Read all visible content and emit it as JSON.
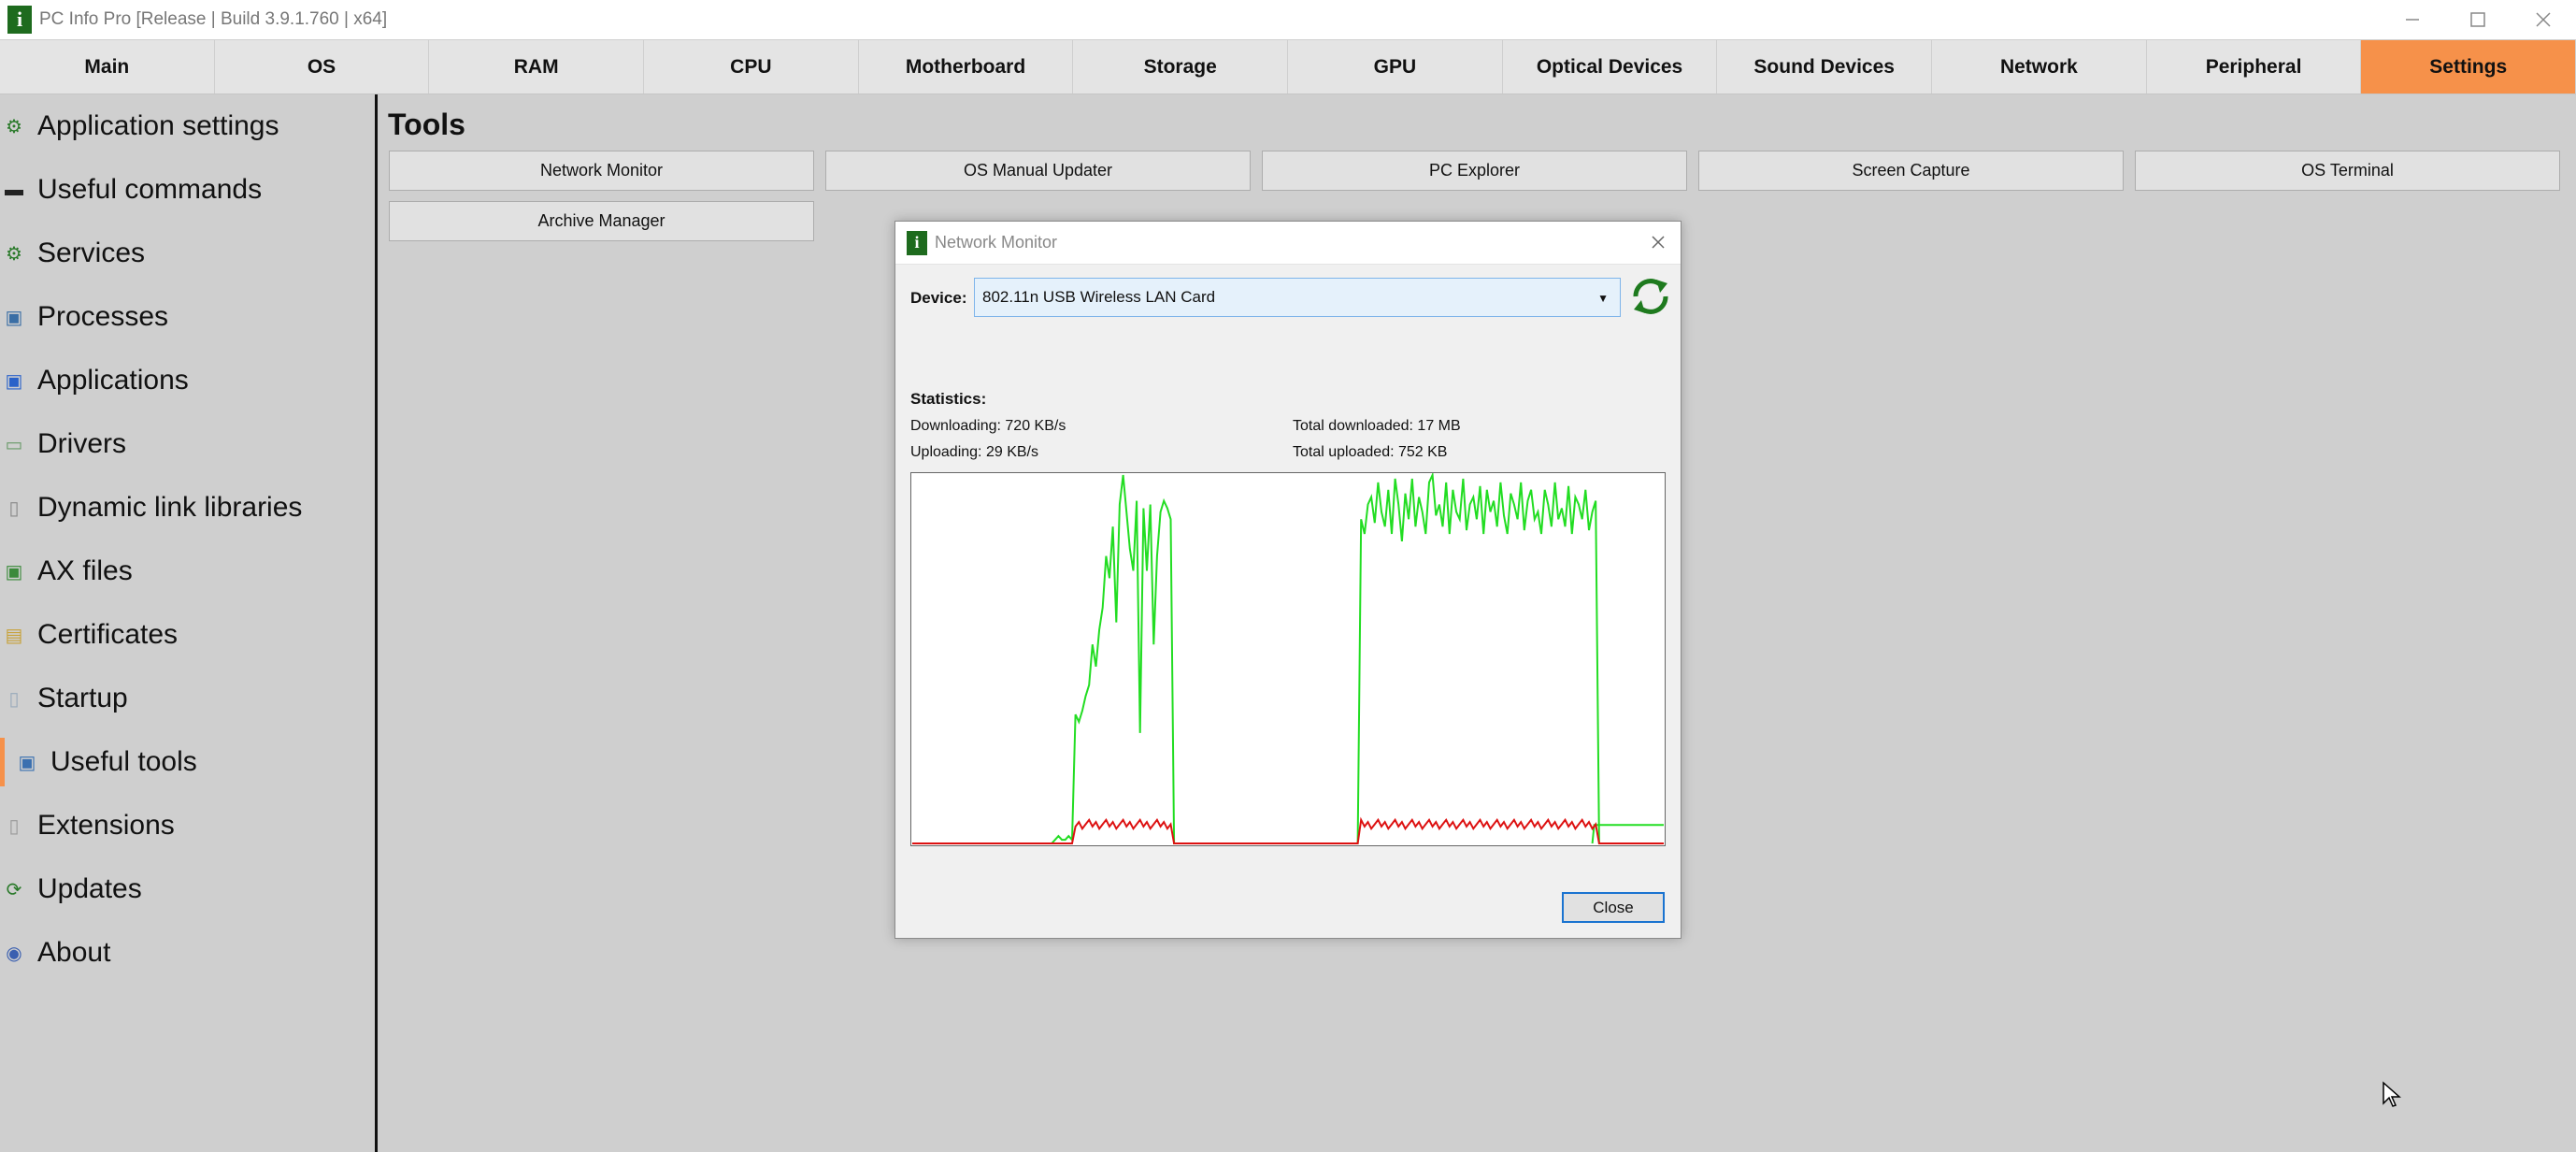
{
  "window": {
    "title": "PC Info Pro [Release | Build 3.9.1.760 | x64]",
    "app_icon_letter": "i"
  },
  "tabs": [
    "Main",
    "OS",
    "RAM",
    "CPU",
    "Motherboard",
    "Storage",
    "GPU",
    "Optical Devices",
    "Sound Devices",
    "Network",
    "Peripheral",
    "Settings"
  ],
  "active_tab": "Settings",
  "sidebar": {
    "items": [
      {
        "label": "Application settings",
        "icon": "gear-icon"
      },
      {
        "label": "Useful commands",
        "icon": "terminal-icon"
      },
      {
        "label": "Services",
        "icon": "gears-icon"
      },
      {
        "label": "Processes",
        "icon": "process-icon"
      },
      {
        "label": "Applications",
        "icon": "application-icon"
      },
      {
        "label": "Drivers",
        "icon": "driver-icon"
      },
      {
        "label": "Dynamic link libraries",
        "icon": "dll-icon"
      },
      {
        "label": "AX files",
        "icon": "ax-file-icon"
      },
      {
        "label": "Certificates",
        "icon": "certificate-icon"
      },
      {
        "label": "Startup",
        "icon": "startup-icon"
      },
      {
        "label": "Useful tools",
        "icon": "tools-icon"
      },
      {
        "label": "Extensions",
        "icon": "extension-icon"
      },
      {
        "label": "Updates",
        "icon": "refresh-icon"
      },
      {
        "label": "About",
        "icon": "about-icon"
      }
    ],
    "selected": "Useful tools"
  },
  "main": {
    "title": "Tools",
    "tools": [
      "Network Monitor",
      "OS Manual Updater",
      "PC Explorer",
      "Screen Capture",
      "OS Terminal",
      "Archive Manager"
    ]
  },
  "dialog": {
    "title": "Network Monitor",
    "device_label": "Device:",
    "device_value": "802.11n USB Wireless LAN Card",
    "statistics_label": "Statistics:",
    "downloading": "Downloading:  720 KB/s",
    "uploading": "Uploading:  29 KB/s",
    "total_downloaded": "Total downloaded:  17 MB",
    "total_uploaded": "Total uploaded:  752 KB",
    "close_label": "Close"
  },
  "colors": {
    "accent": "#f6914a",
    "download_line": "#22dd22",
    "upload_line": "#dd1111",
    "brand_green": "#1e6b1e"
  },
  "graph_data": {
    "download": [
      0,
      0,
      0,
      0,
      0,
      0,
      0,
      0,
      0,
      0,
      0,
      0,
      0,
      0,
      0,
      0,
      0,
      0,
      0,
      0,
      0,
      0,
      0,
      0,
      0,
      0,
      0,
      0,
      0,
      0,
      0,
      0,
      0,
      0,
      0,
      0,
      0,
      0,
      0,
      0,
      0,
      0,
      1,
      2,
      1,
      1,
      2,
      1,
      35,
      33,
      36,
      40,
      43,
      54,
      48,
      58,
      64,
      78,
      72,
      86,
      60,
      92,
      100,
      90,
      80,
      74,
      93,
      30,
      91,
      74,
      92,
      54,
      78,
      90,
      93,
      91,
      88,
      0,
      0,
      0,
      0,
      0,
      0,
      0,
      0,
      0,
      0,
      0,
      0,
      0,
      0,
      0,
      0,
      0,
      0,
      0,
      0,
      0,
      0,
      0,
      0,
      0,
      0,
      0,
      0,
      0,
      0,
      0,
      0,
      0,
      0,
      0,
      0,
      0,
      0,
      0,
      0,
      0,
      0,
      0,
      0,
      0,
      0,
      0,
      0,
      0,
      0,
      0,
      0,
      0,
      0,
      0,
      88,
      84,
      92,
      94,
      87,
      98,
      90,
      86,
      96,
      84,
      99,
      92,
      82,
      95,
      88,
      99,
      86,
      94,
      90,
      84,
      98,
      100,
      89,
      92,
      86,
      98,
      84,
      96,
      90,
      88,
      99,
      85,
      92,
      94,
      88,
      97,
      84,
      96,
      90,
      93,
      86,
      98,
      89,
      84,
      95,
      92,
      88,
      98,
      85,
      93,
      96,
      88,
      90,
      84,
      96,
      92,
      86,
      98,
      88,
      91,
      86,
      97,
      84,
      94,
      92,
      88,
      96,
      85,
      90,
      93,
      0,
      0,
      0,
      0,
      0,
      0,
      0,
      0,
      0,
      0,
      0,
      0,
      0,
      0,
      0,
      0,
      0,
      0,
      0,
      0
    ],
    "tail_level": 5
  }
}
